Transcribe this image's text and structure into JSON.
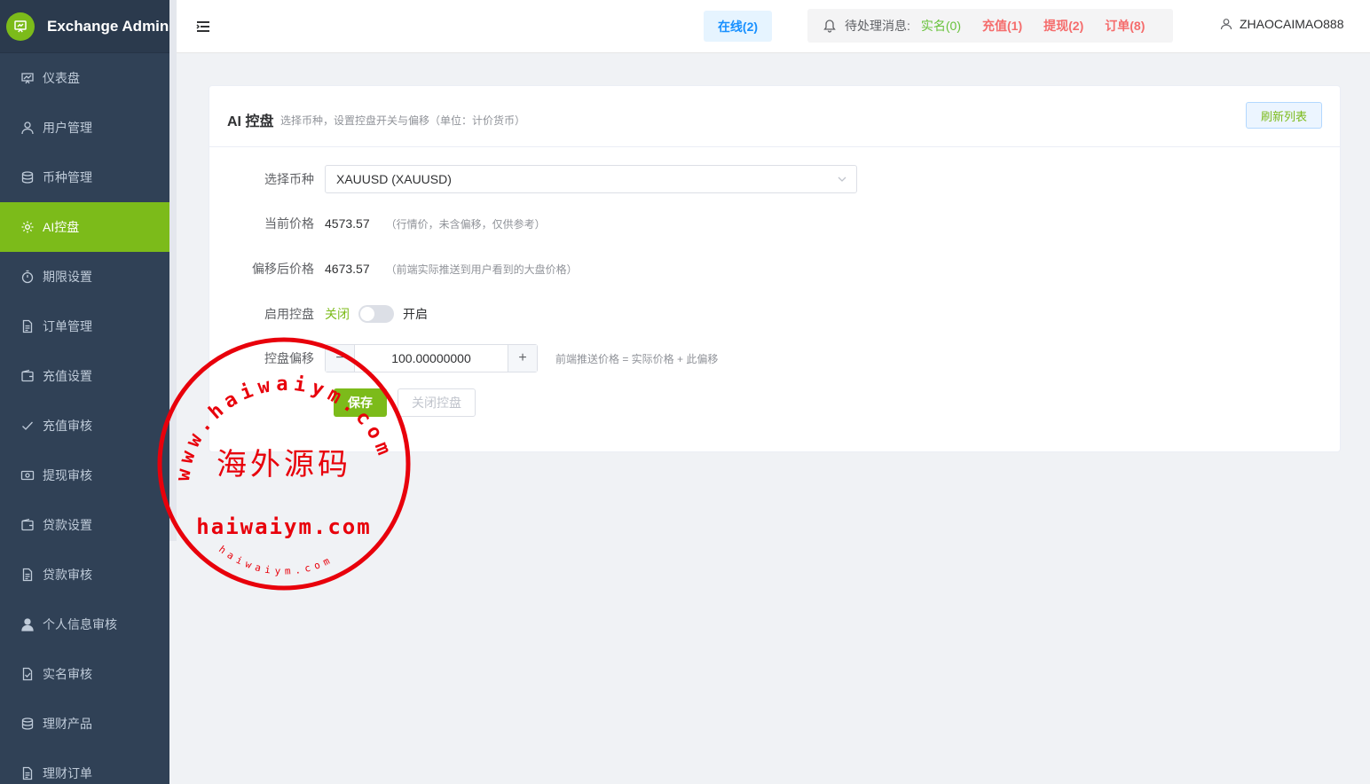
{
  "brand": {
    "title": "Exchange Admin"
  },
  "sidebar": {
    "items": [
      {
        "label": "仪表盘",
        "icon": "dashboard-icon",
        "active": false
      },
      {
        "label": "用户管理",
        "icon": "user-icon",
        "active": false
      },
      {
        "label": "币种管理",
        "icon": "database-icon",
        "active": false
      },
      {
        "label": "AI控盘",
        "icon": "gear-icon",
        "active": true
      },
      {
        "label": "期限设置",
        "icon": "stopwatch-icon",
        "active": false
      },
      {
        "label": "订单管理",
        "icon": "document-icon",
        "active": false
      },
      {
        "label": "充值设置",
        "icon": "wallet-icon",
        "active": false
      },
      {
        "label": "充值审核",
        "icon": "check-icon",
        "active": false
      },
      {
        "label": "提现审核",
        "icon": "money-icon",
        "active": false
      },
      {
        "label": "贷款设置",
        "icon": "wallet-icon",
        "active": false
      },
      {
        "label": "贷款审核",
        "icon": "document-icon",
        "active": false
      },
      {
        "label": "个人信息审核",
        "icon": "person-icon",
        "active": false
      },
      {
        "label": "实名审核",
        "icon": "document-check-icon",
        "active": false
      },
      {
        "label": "理财产品",
        "icon": "database-icon",
        "active": false
      },
      {
        "label": "理财订单",
        "icon": "document-icon",
        "active": false
      }
    ]
  },
  "header": {
    "online": "在线(2)",
    "pending_label": "待处理消息:",
    "pending": {
      "realname": "实名(0)",
      "recharge": "充值(1)",
      "withdraw": "提现(2)",
      "order": "订单(8)"
    },
    "username": "ZHAOCAIMAO888"
  },
  "card": {
    "title": "AI 控盘",
    "subtitle": "选择币种，设置控盘开关与偏移（单位：计价货币）",
    "refresh_label": "刷新列表"
  },
  "form": {
    "symbol_label": "选择币种",
    "symbol_value": "XAUUSD (XAUUSD)",
    "current_price_label": "当前价格",
    "current_price": "4573.57",
    "current_price_hint": "（行情价，未含偏移，仅供参考）",
    "offset_price_label": "偏移后价格",
    "offset_price": "4673.57",
    "offset_price_hint": "（前端实际推送到用户看到的大盘价格）",
    "enable_label": "启用控盘",
    "off_label": "关闭",
    "on_label": "开启",
    "enabled": false,
    "offset_label": "控盘偏移",
    "offset_value": "100.00000000",
    "offset_hint": "前端推送价格 = 实际价格 + 此偏移",
    "save_label": "保存",
    "close_label": "关闭控盘"
  },
  "watermark": {
    "top_arc": "www.haiwaiym.com",
    "center": "海外源码",
    "middle": "haiwaiym.com",
    "bottom_arc": "haiwaiym.com"
  },
  "colors": {
    "accent": "#7cbb1a",
    "sidebar_bg": "#304156",
    "link_blue": "#1890ff",
    "danger": "#f56c6c",
    "success": "#67c23a",
    "stamp_red": "#e8000b"
  }
}
